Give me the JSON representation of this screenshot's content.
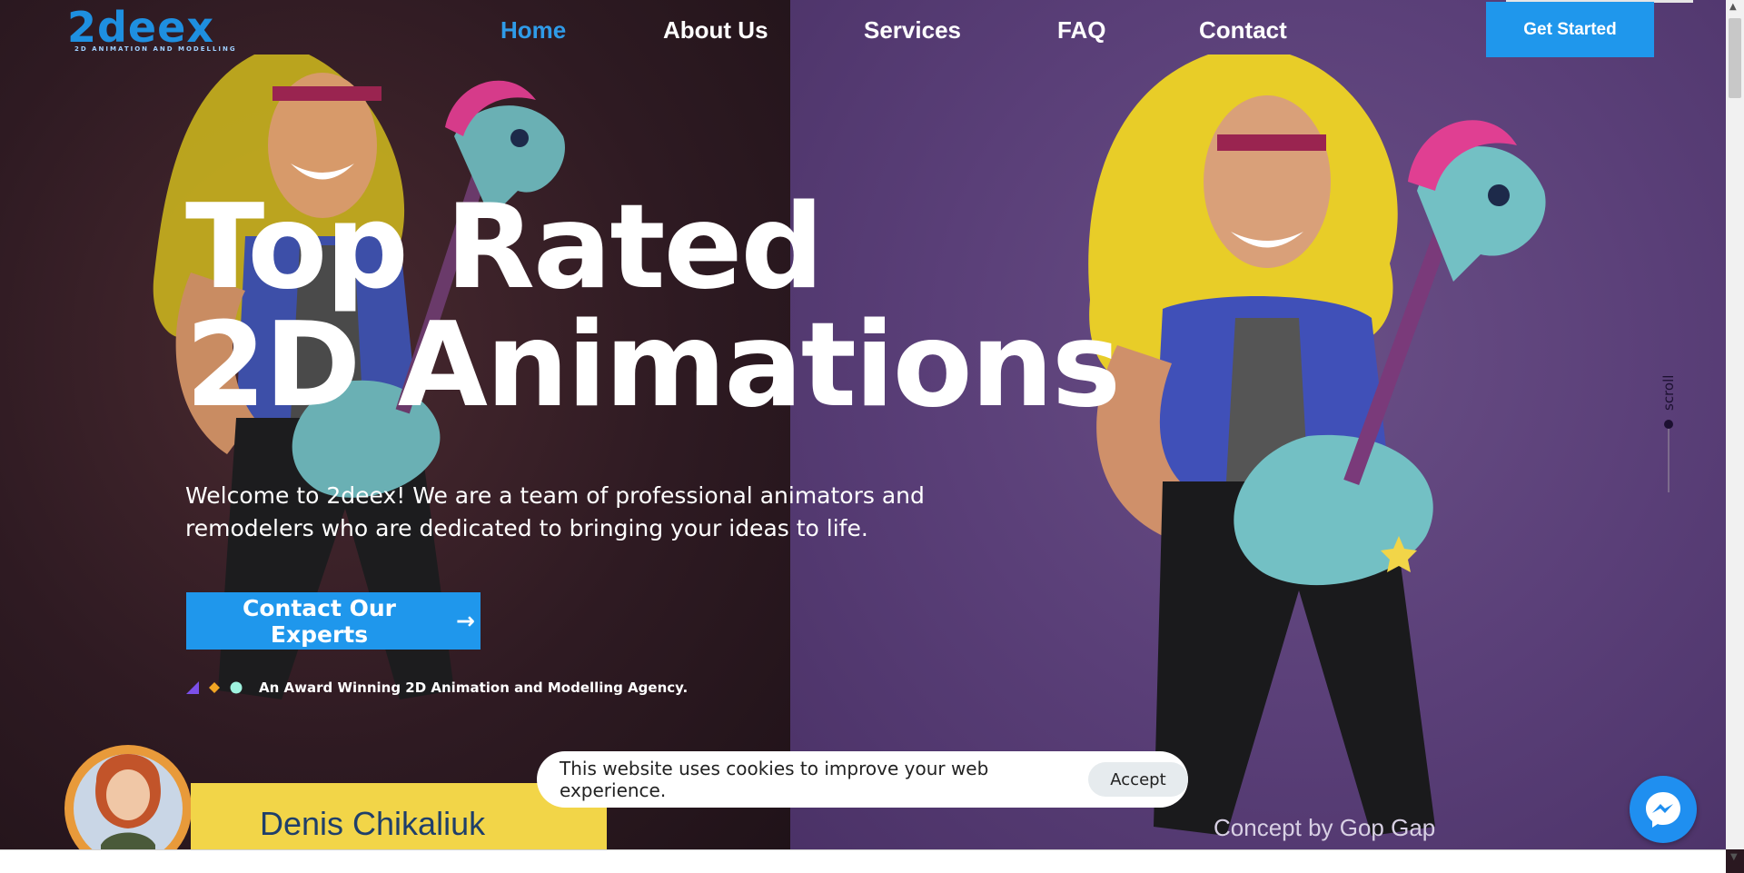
{
  "logo": {
    "name": "2deex",
    "tagline": "2D ANIMATION AND MODELLING"
  },
  "nav": {
    "items": [
      {
        "label": "Home",
        "active": true
      },
      {
        "label": "About Us",
        "active": false
      },
      {
        "label": "Services",
        "active": false
      },
      {
        "label": "FAQ",
        "active": false
      },
      {
        "label": "Contact",
        "active": false
      }
    ],
    "cta_label": "Get Started"
  },
  "hero": {
    "headline_line1": "Top Rated",
    "headline_line2": "2D Animations",
    "intro_line1": "Welcome to 2deex! We are a team of professional animators and",
    "intro_line2": "remodelers who are dedicated to bringing your ideas to life.",
    "cta_label": "Contact Our Experts",
    "cta_arrow": "→",
    "award_text": "An Award Winning 2D Animation and Modelling Agency.",
    "concept_credit": "Concept by Gop Gap",
    "banner_name": "Denis Chikaliuk"
  },
  "scroll_indicator": {
    "label": "scroll"
  },
  "cookie": {
    "message": "This website uses cookies to improve your web experience.",
    "accept_label": "Accept"
  },
  "colors": {
    "accent": "#1f97ec",
    "active_nav": "#2f9be8",
    "bg_left": "#2e1a22",
    "bg_right": "#5a3f78",
    "banner": "#f2d548"
  },
  "icons": {
    "messenger": "messenger-icon",
    "award_shapes": [
      "triangle-icon",
      "diamond-icon",
      "circle-icon"
    ]
  }
}
